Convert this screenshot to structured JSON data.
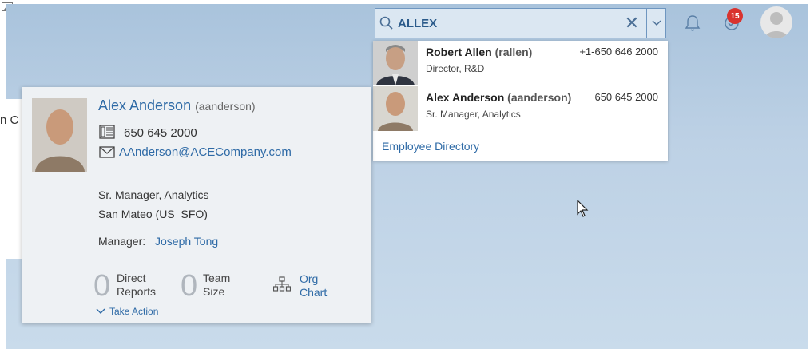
{
  "search": {
    "value": "ALLEX",
    "clear_glyph": "✕"
  },
  "notifications": {
    "task_count": "15"
  },
  "suggestions": {
    "items": [
      {
        "name": "Robert Allen",
        "user_id": "(rallen)",
        "title": "Director, R&D",
        "phone": "+1-650 646 2000"
      },
      {
        "name": "Alex Anderson",
        "user_id": "(aanderson)",
        "title": "Sr. Manager, Analytics",
        "phone": "650 645 2000"
      }
    ],
    "directory_link": "Employee Directory"
  },
  "background": {
    "cut_text": "n C"
  },
  "card": {
    "name": "Alex Anderson",
    "user_id": "(aanderson)",
    "phone": "650 645 2000",
    "email": "AAnderson@ACECompany.com",
    "job_title": "Sr. Manager, Analytics",
    "location": "San Mateo (US_SFO)",
    "manager_label": "Manager:",
    "manager_name": "Joseph Tong",
    "direct_reports_count": "0",
    "direct_reports_label_1": "Direct",
    "direct_reports_label_2": "Reports",
    "team_size_count": "0",
    "team_size_label_1": "Team",
    "team_size_label_2": "Size",
    "org_chart_label_1": "Org",
    "org_chart_label_2": "Chart",
    "take_action": "Take Action"
  },
  "colors": {
    "link": "#2e6aa6",
    "badge": "#d9332f",
    "background": "#bdd1e5"
  },
  "icons": [
    "image-placeholder-icon",
    "search-icon",
    "close-icon",
    "chevron-down-icon",
    "bell-icon",
    "task-check-icon",
    "user-avatar-icon",
    "phone-icon",
    "mail-icon",
    "org-chart-icon",
    "mouse-cursor-icon"
  ]
}
